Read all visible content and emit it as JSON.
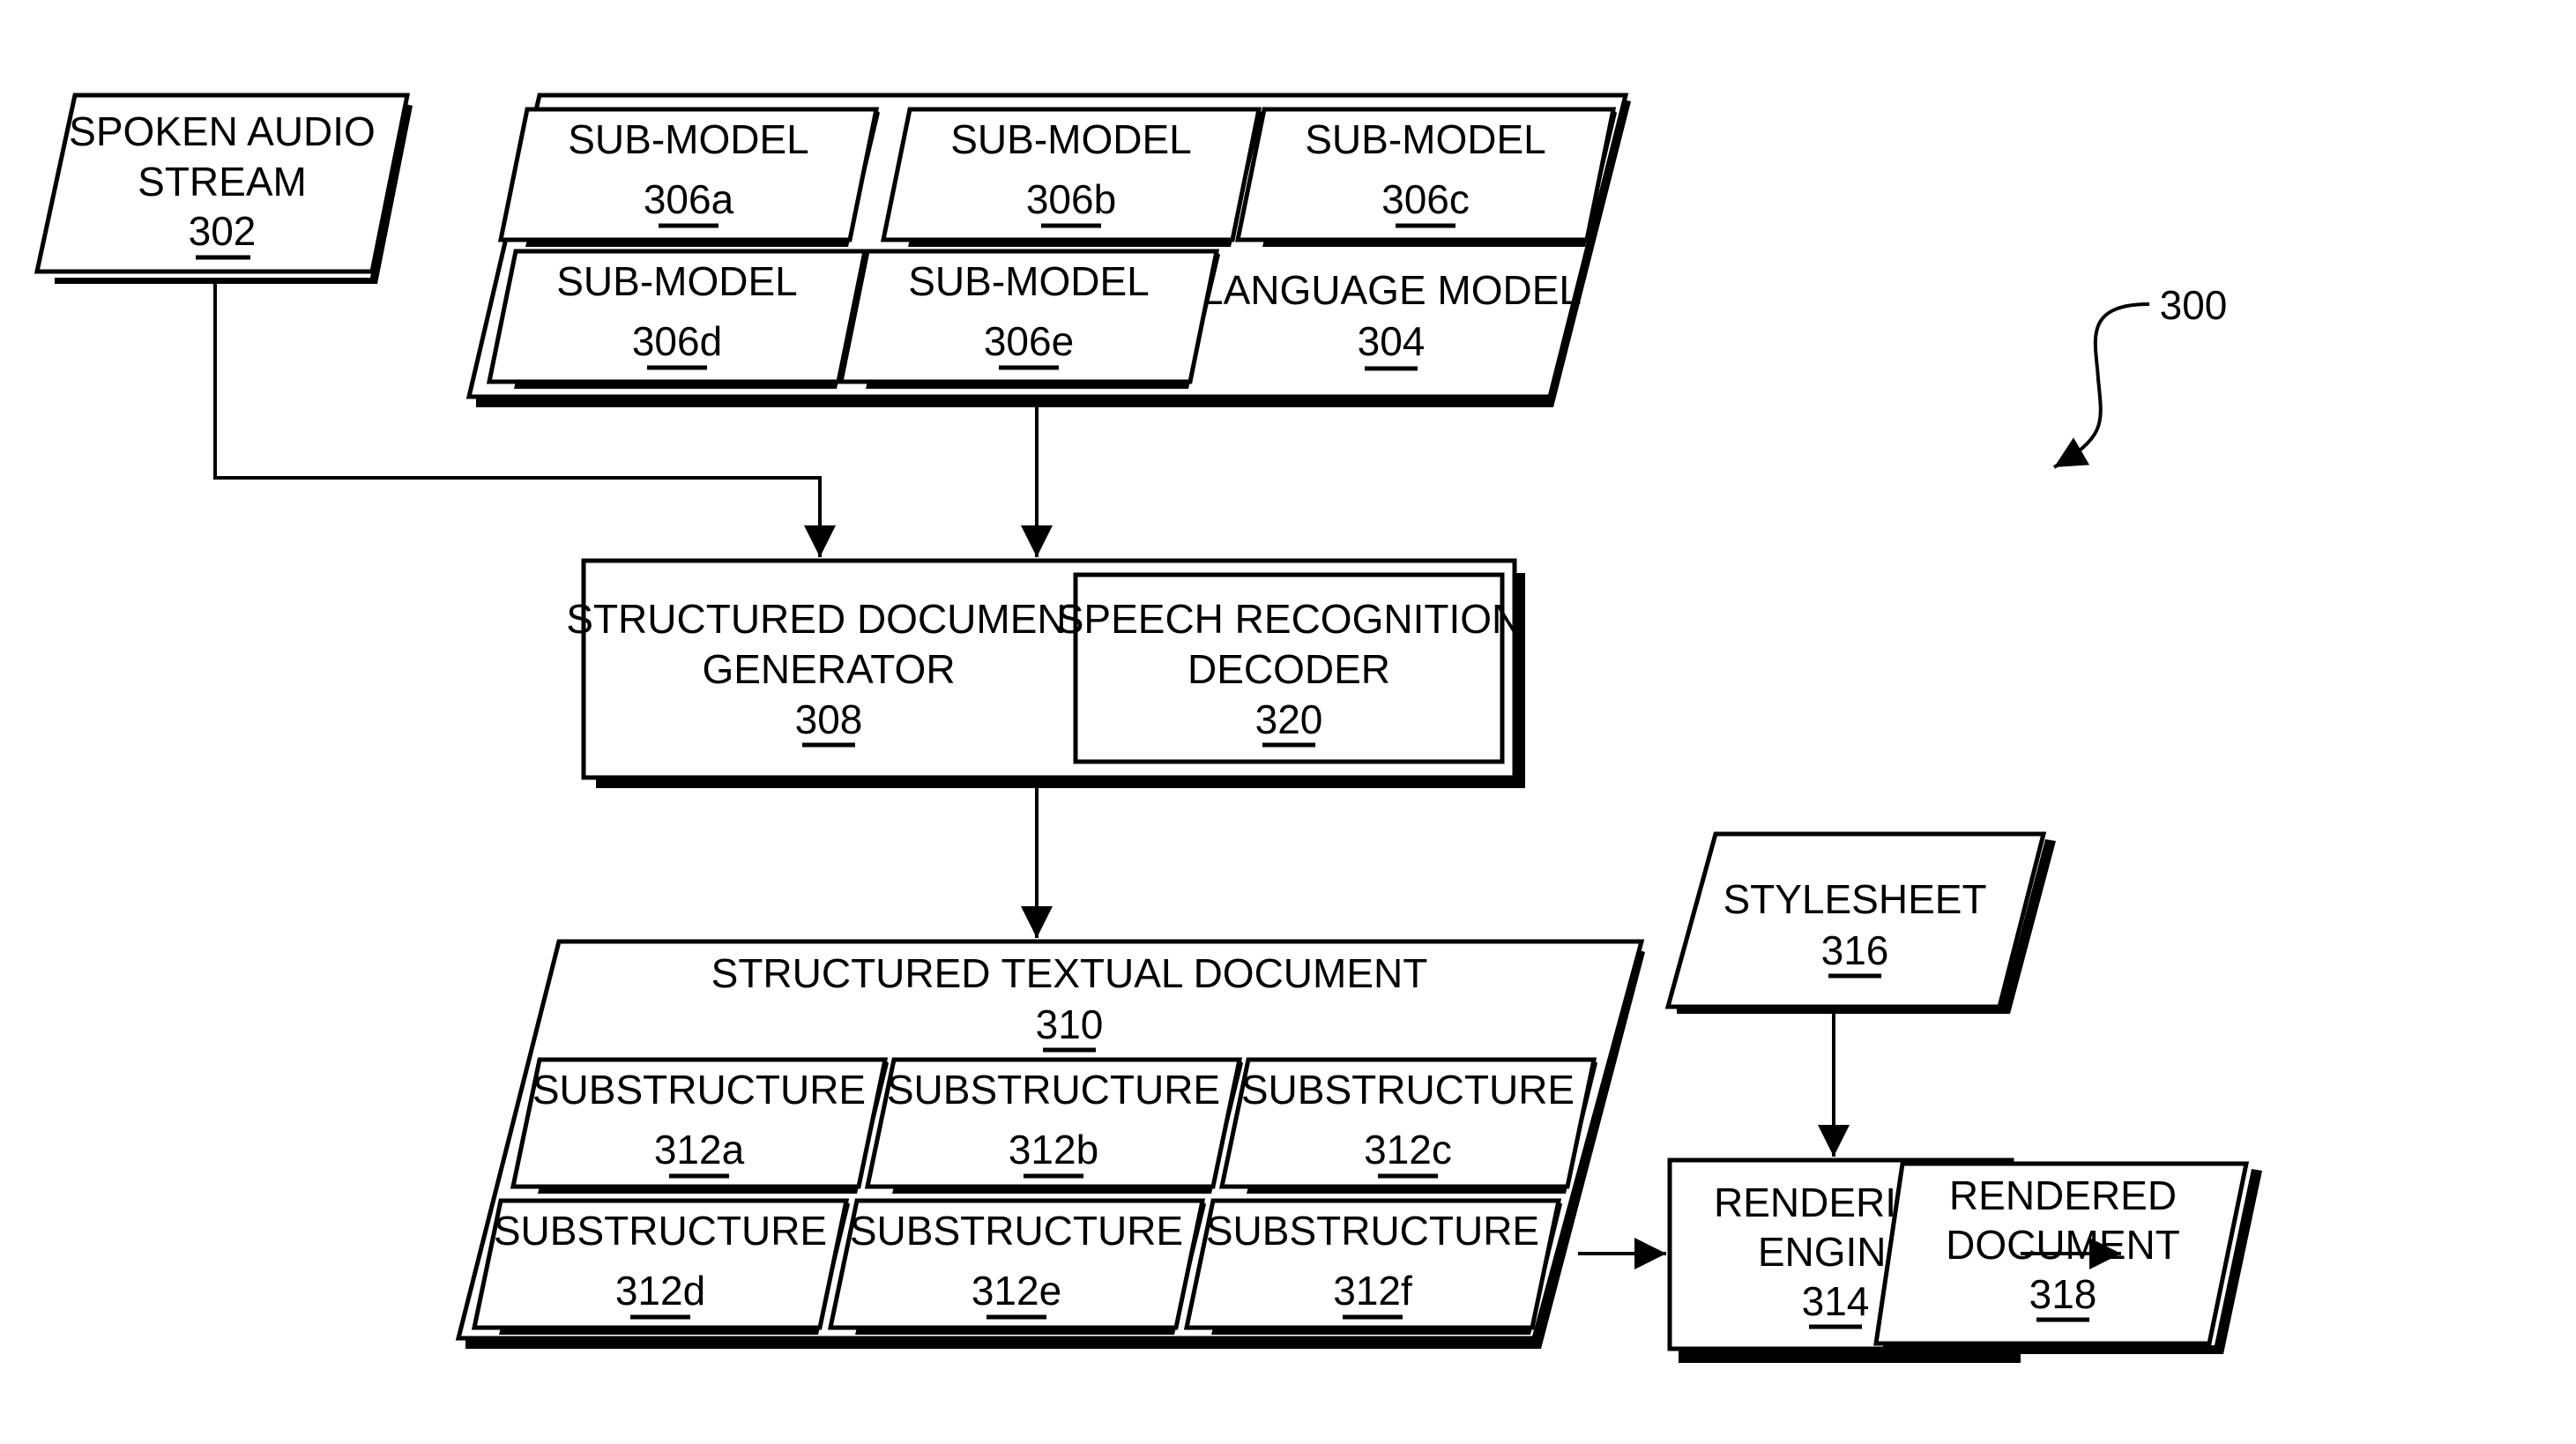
{
  "figure": {
    "reference_label": "300",
    "nodes": {
      "spoken_audio": {
        "lines": [
          "SPOKEN AUDIO",
          "STREAM"
        ],
        "ref": "302"
      },
      "language_model": {
        "lines": [
          "LANGUAGE MODEL"
        ],
        "ref": "304"
      },
      "submodels": [
        {
          "lines": [
            "SUB-MODEL"
          ],
          "ref": "306a"
        },
        {
          "lines": [
            "SUB-MODEL"
          ],
          "ref": "306b"
        },
        {
          "lines": [
            "SUB-MODEL"
          ],
          "ref": "306c"
        },
        {
          "lines": [
            "SUB-MODEL"
          ],
          "ref": "306d"
        },
        {
          "lines": [
            "SUB-MODEL"
          ],
          "ref": "306e"
        }
      ],
      "doc_generator": {
        "lines": [
          "STRUCTURED DOCUMENT",
          "GENERATOR"
        ],
        "ref": "308"
      },
      "decoder": {
        "lines": [
          "SPEECH RECOGNITION",
          "DECODER"
        ],
        "ref": "320"
      },
      "textual_doc": {
        "lines": [
          "STRUCTURED TEXTUAL DOCUMENT"
        ],
        "ref": "310"
      },
      "substructures": [
        {
          "lines": [
            "SUBSTRUCTURE"
          ],
          "ref": "312a"
        },
        {
          "lines": [
            "SUBSTRUCTURE"
          ],
          "ref": "312b"
        },
        {
          "lines": [
            "SUBSTRUCTURE"
          ],
          "ref": "312c"
        },
        {
          "lines": [
            "SUBSTRUCTURE"
          ],
          "ref": "312d"
        },
        {
          "lines": [
            "SUBSTRUCTURE"
          ],
          "ref": "312e"
        },
        {
          "lines": [
            "SUBSTRUCTURE"
          ],
          "ref": "312f"
        }
      ],
      "stylesheet": {
        "lines": [
          "STYLESHEET"
        ],
        "ref": "316"
      },
      "rendering_engine": {
        "lines": [
          "RENDERING",
          "ENGINE"
        ],
        "ref": "314"
      },
      "rendered_doc": {
        "lines": [
          "RENDERED",
          "DOCUMENT"
        ],
        "ref": "318"
      }
    },
    "edges": [
      {
        "from": "302",
        "to": "308"
      },
      {
        "from": "304",
        "to": "308"
      },
      {
        "from": "308",
        "to": "310"
      },
      {
        "from": "310",
        "to": "314"
      },
      {
        "from": "316",
        "to": "314"
      },
      {
        "from": "314",
        "to": "318"
      }
    ]
  }
}
